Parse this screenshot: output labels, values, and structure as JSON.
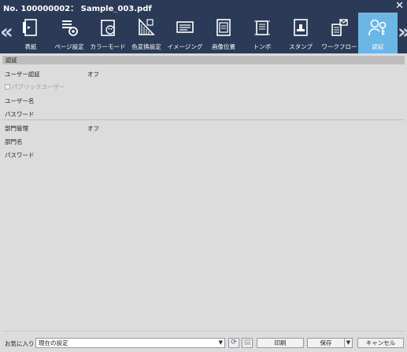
{
  "window": {
    "title": "No. 100000002： Sample_003.pdf",
    "close_glyph": "✕"
  },
  "toolbar": {
    "scroll_left": "«",
    "scroll_right": "»",
    "tabs": [
      {
        "label": "表紙",
        "icon": "cover-icon",
        "active": false
      },
      {
        "label": "ページ設定",
        "icon": "page-settings-icon",
        "active": false
      },
      {
        "label": "カラーモード",
        "icon": "color-mode-icon",
        "active": false
      },
      {
        "label": "色変換設定",
        "icon": "color-conversion-icon",
        "active": false
      },
      {
        "label": "イメージング",
        "icon": "imaging-icon",
        "active": false
      },
      {
        "label": "画像位置",
        "icon": "image-position-icon",
        "active": false
      },
      {
        "label": "トンボ",
        "icon": "crop-marks-icon",
        "active": false
      },
      {
        "label": "スタンプ",
        "icon": "stamp-icon",
        "active": false
      },
      {
        "label": "ワークフロー",
        "icon": "workflow-icon",
        "active": false
      },
      {
        "label": "認証",
        "icon": "authentication-icon",
        "active": true
      }
    ]
  },
  "auth": {
    "section_title": "認証",
    "user_auth_label": "ユーザー認証",
    "user_auth_value": "オフ",
    "public_user_label": "パブリックユーザー",
    "username_label": "ユーザー名",
    "password_label": "パスワード",
    "dept_mgmt_label": "部門管理",
    "dept_mgmt_value": "オフ",
    "dept_name_label": "部門名",
    "dept_password_label": "パスワード"
  },
  "footer": {
    "favorites_label": "お気に入り",
    "favorites_value": "現在の設定",
    "dropdown_glyph": "▼",
    "refresh_glyph": "⟳",
    "save_glyph": "▤",
    "print_label": "印刷",
    "save_label": "保存",
    "cancel_label": "キャンセル"
  },
  "colors": {
    "header_bg": "#2b3a57",
    "active_tab": "#6cb6e6",
    "body_bg": "#dcdcdc"
  }
}
